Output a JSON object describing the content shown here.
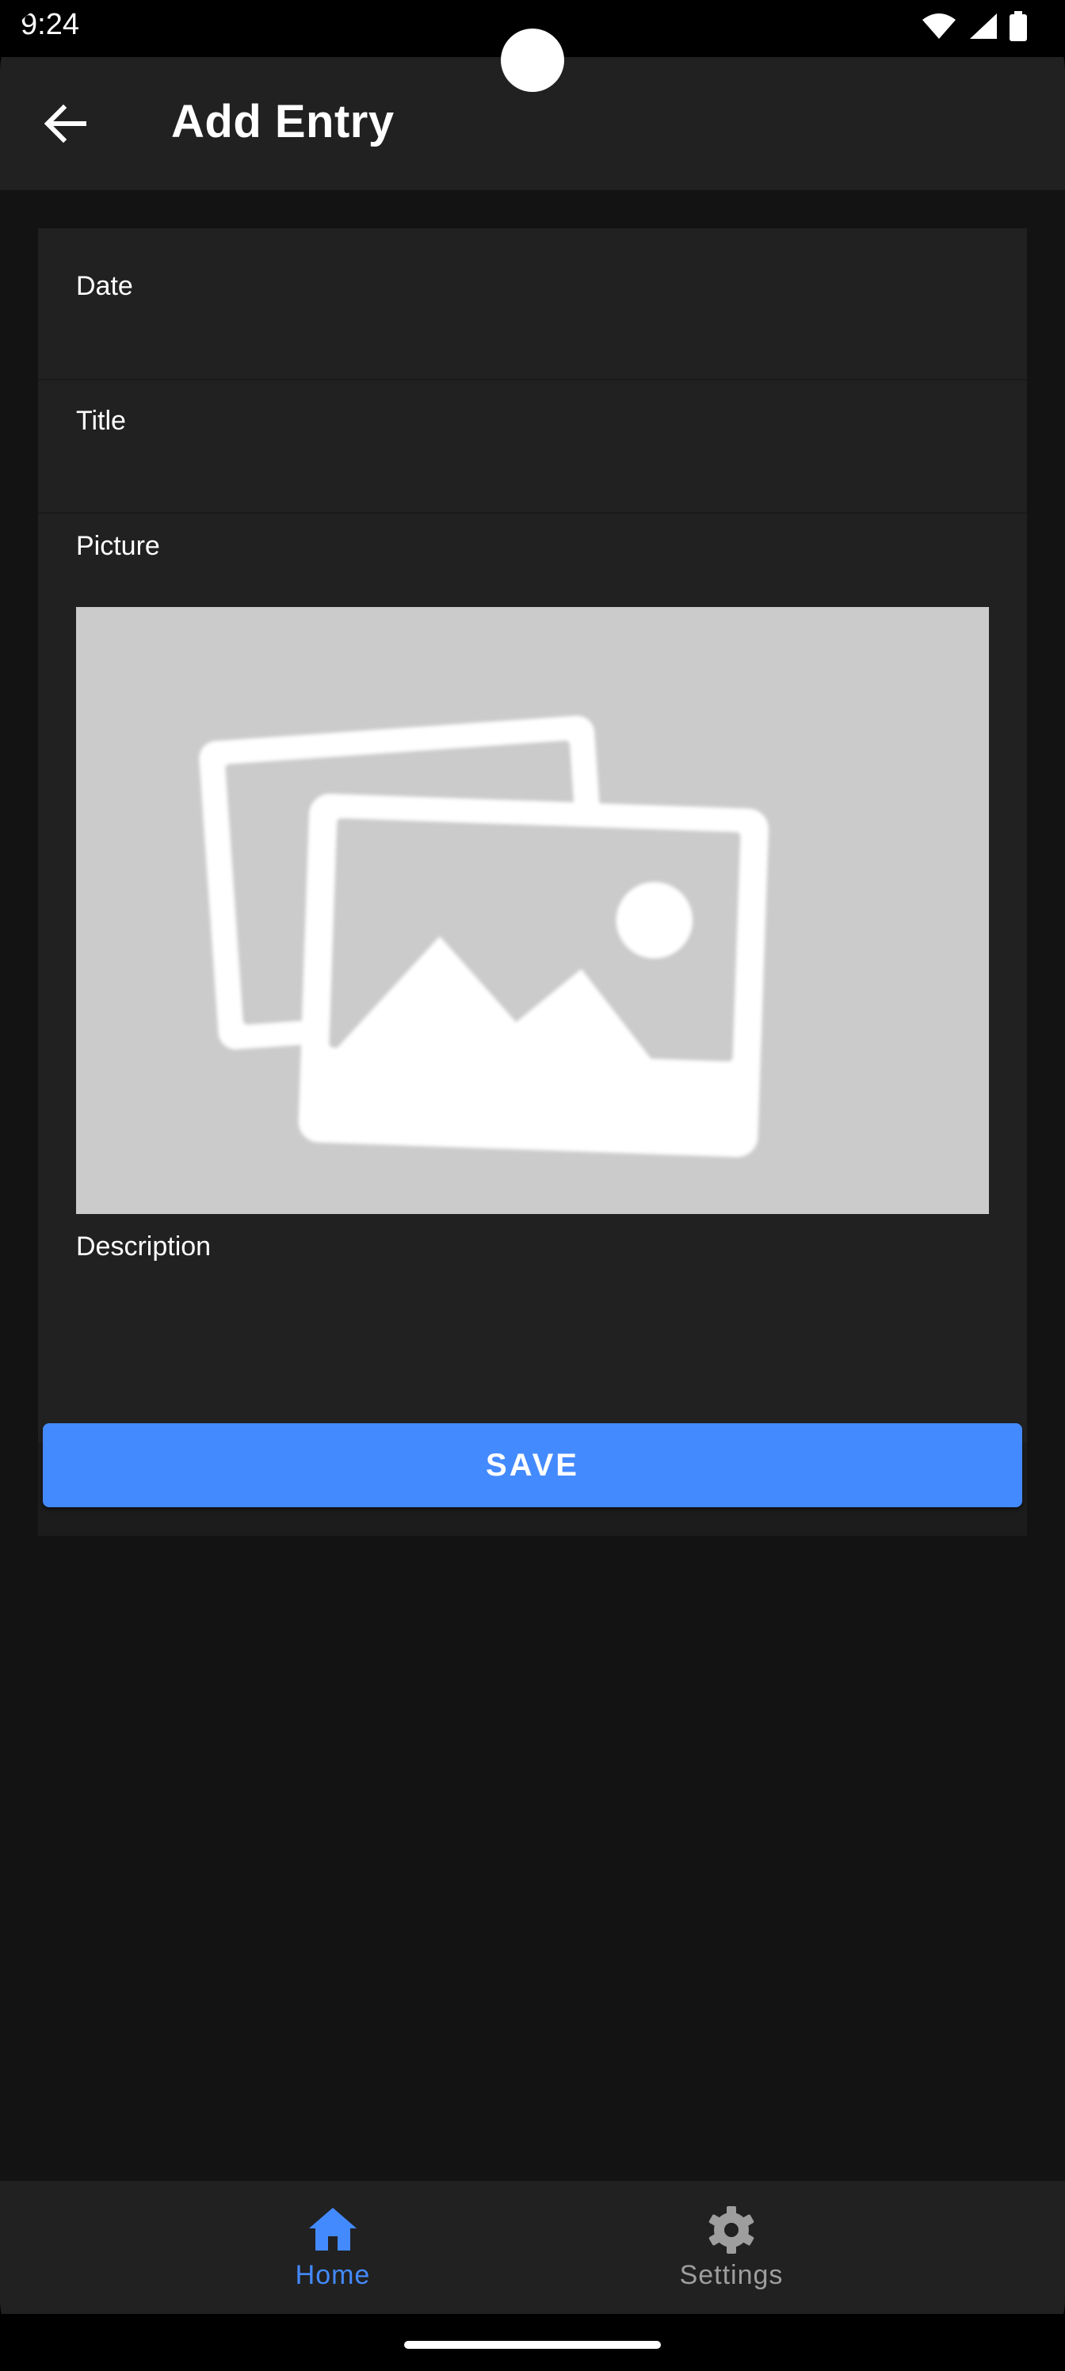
{
  "status_bar": {
    "time": "9:24"
  },
  "app_bar": {
    "title": "Add Entry"
  },
  "form": {
    "date_label": "Date",
    "title_label": "Title",
    "picture_label": "Picture",
    "description_label": "Description",
    "save_label": "SAVE"
  },
  "bottom_nav": {
    "items": [
      {
        "label": "Home",
        "icon": "home-icon",
        "active": true
      },
      {
        "label": "Settings",
        "icon": "gear-icon",
        "active": false
      }
    ]
  },
  "colors": {
    "accent": "#448aff",
    "background": "#131313",
    "surface": "#212121",
    "placeholder": "#cbcbcb"
  }
}
